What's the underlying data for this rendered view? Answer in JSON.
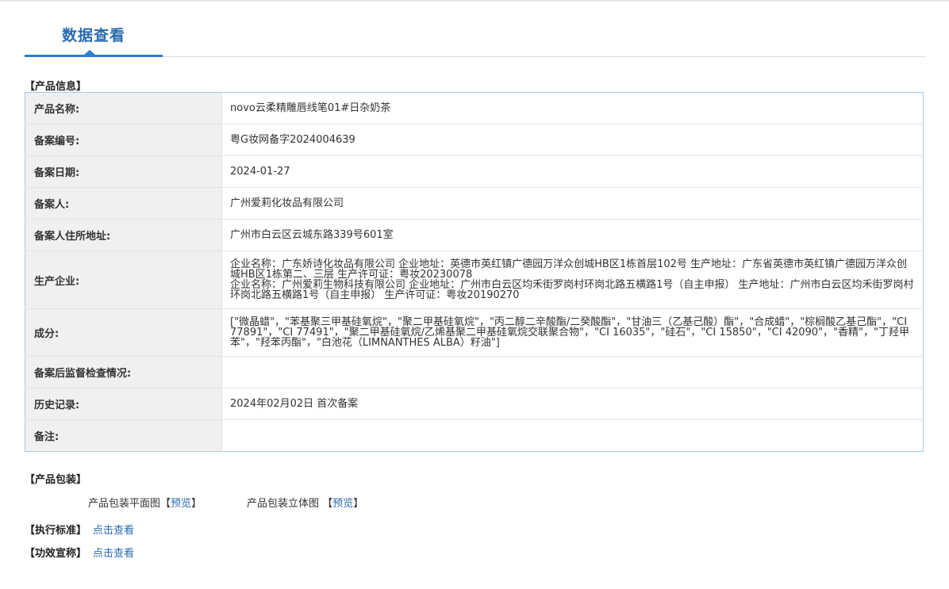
{
  "tab": {
    "label": "数据查看"
  },
  "sections": {
    "product_info": "【产品信息】",
    "packaging": "【产品包装】",
    "standard": "【执行标准】",
    "efficacy": "【功效宣称】"
  },
  "info_rows": [
    {
      "label": "产品名称:",
      "value": "novo云柔精雕唇线笔01#日杂奶茶"
    },
    {
      "label": "备案编号:",
      "value": "粤G妆网备字2024004639"
    },
    {
      "label": "备案日期:",
      "value": "2024-01-27"
    },
    {
      "label": "备案人:",
      "value": "广州爱莉化妆品有限公司"
    },
    {
      "label": "备案人住所地址:",
      "value": "广州市白云区云城东路339号601室"
    },
    {
      "label": "生产企业:",
      "value_lines": [
        "企业名称：广东娇诗化妆品有限公司 企业地址：英德市英红镇广德园万洋众创城HB区1栋首层102号 生产地址：广东省英德市英红镇广德园万洋众创城HB区1栋第二、三层 生产许可证：粤妆20230078",
        "企业名称：广州爱莉生物科技有限公司 企业地址：广州市白云区均禾街罗岗村环岗北路五横路1号（自主申报） 生产地址：广州市白云区均禾街罗岗村环岗北路五横路1号（自主申报） 生产许可证：粤妆20190270"
      ]
    },
    {
      "label": "成分:",
      "value": "[\"微晶蜡\"，\"苯基聚三甲基硅氧烷\"，\"聚二甲基硅氧烷\"，\"丙二醇二辛酸酯/二癸酸酯\"，\"甘油三（乙基己酸）酯\"，\"合成蜡\"，\"棕榈酸乙基己酯\"，\"CI 77891\"，\"CI 77491\"，\"聚二甲基硅氧烷/乙烯基聚二甲基硅氧烷交联聚合物\"，\"CI 16035\"，\"硅石\"，\"CI 15850\"，\"CI 42090\"，\"香精\"，\"丁羟甲苯\"，\"羟苯丙酯\"，\"白池花（LIMNANTHES ALBA）籽油\"]"
    },
    {
      "label": "备案后监督检查情况:",
      "value": ""
    },
    {
      "label": "历史记录:",
      "value": "2024年02月02日 首次备案"
    },
    {
      "label": "备注:",
      "value": ""
    }
  ],
  "packaging": {
    "flat": {
      "label": "产品包装平面图",
      "link": "预览"
    },
    "solid": {
      "label": "产品包装立体图",
      "link": "预览"
    }
  },
  "links": {
    "standard": "点击查看",
    "efficacy": "点击查看"
  }
}
